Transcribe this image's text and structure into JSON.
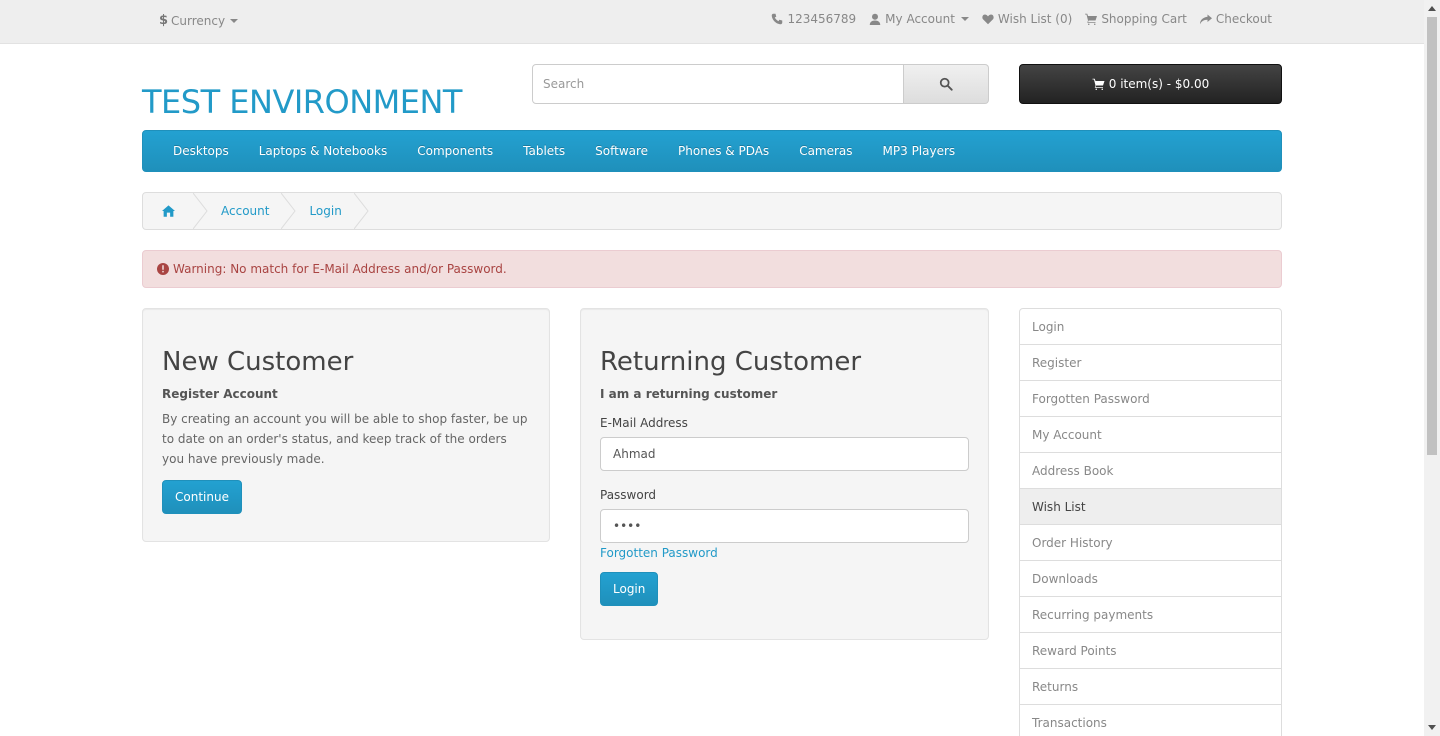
{
  "topbar": {
    "currency_symbol": "$",
    "currency_label": "Currency",
    "phone": "123456789",
    "my_account": "My Account",
    "wishlist": "Wish List (0)",
    "shopping_cart": "Shopping Cart",
    "checkout": "Checkout"
  },
  "header": {
    "logo": "TEST ENVIRONMENT",
    "search_placeholder": "Search",
    "cart_label": "0 item(s) - $0.00"
  },
  "menu": [
    "Desktops",
    "Laptops & Notebooks",
    "Components",
    "Tablets",
    "Software",
    "Phones & PDAs",
    "Cameras",
    "MP3 Players"
  ],
  "breadcrumb": [
    "Account",
    "Login"
  ],
  "alert": "Warning: No match for E-Mail Address and/or Password.",
  "new_customer": {
    "title": "New Customer",
    "subtitle": "Register Account",
    "description": "By creating an account you will be able to shop faster, be up to date on an order's status, and keep track of the orders you have previously made.",
    "button": "Continue"
  },
  "returning_customer": {
    "title": "Returning Customer",
    "subtitle": "I am a returning customer",
    "email_label": "E-Mail Address",
    "email_value": "Ahmad",
    "password_label": "Password",
    "password_value": "••••",
    "forgotten": "Forgotten Password",
    "button": "Login"
  },
  "sidebar": [
    "Login",
    "Register",
    "Forgotten Password",
    "My Account",
    "Address Book",
    "Wish List",
    "Order History",
    "Downloads",
    "Recurring payments",
    "Reward Points",
    "Returns",
    "Transactions"
  ],
  "sidebar_active_index": 5,
  "colors": {
    "brand": "#229ac8",
    "alert_bg": "#f2dede",
    "alert_text": "#a94442"
  }
}
